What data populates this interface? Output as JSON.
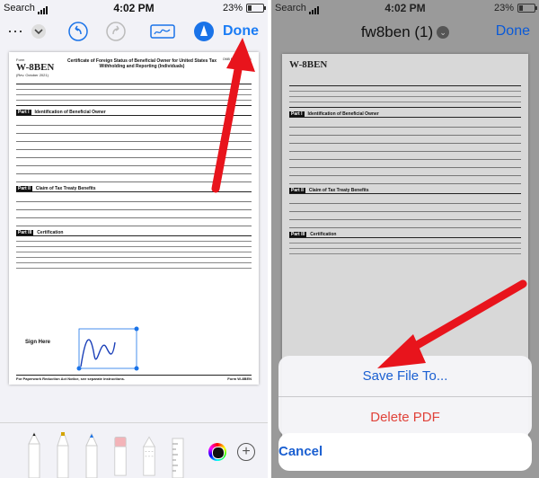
{
  "left": {
    "status": {
      "carrier": "Search",
      "time": "4:02 PM",
      "battery": "23%",
      "battery_level": 0.23
    },
    "toolbar": {
      "more_icon": "ellipsis-icon",
      "done_label": "Done"
    },
    "form": {
      "form_number": "W-8BEN",
      "rev": "(Rev. October 2021)",
      "title": "Certificate of Foreign Status of Beneficial Owner for United States Tax Withholding and Reporting (Individuals)",
      "omb": "OMB No. 1545-1621",
      "part1": "Identification of Beneficial Owner",
      "part2": "Claim of Tax Treaty Benefits",
      "part3": "Certification",
      "sign_here": "Sign Here",
      "footer_left": "For Paperwork Reduction Act Notice, see separate instructions.",
      "footer_right": "Form W-8BEN"
    }
  },
  "right": {
    "status": {
      "carrier": "Search",
      "time": "4:02 PM",
      "battery": "23%",
      "battery_level": 0.23
    },
    "title": "fw8ben (1)",
    "done_label": "Done",
    "form": {
      "form_number": "W-8BEN",
      "part1": "Identification of Beneficial Owner",
      "part2": "Claim of Tax Treaty Benefits",
      "part3": "Certification"
    },
    "sheet": {
      "save": "Save File To...",
      "delete": "Delete PDF",
      "cancel": "Cancel"
    }
  },
  "colors": {
    "accent": "#1a7cf5",
    "destructive": "#e0433a",
    "arrow": "#e8141c"
  }
}
